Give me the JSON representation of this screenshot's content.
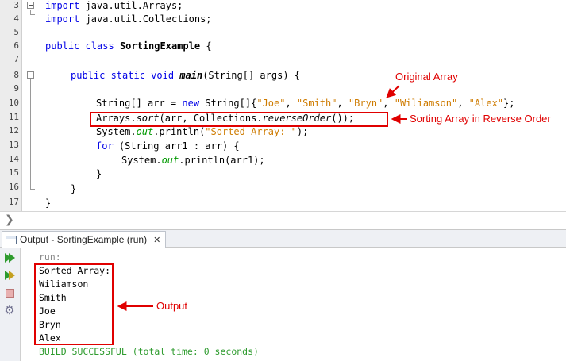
{
  "editor": {
    "line_numbers": [
      "3",
      "4",
      "5",
      "6",
      "7",
      "8",
      "9",
      "10",
      "11",
      "12",
      "13",
      "14",
      "15",
      "16",
      "17"
    ],
    "code": {
      "l3": [
        "import",
        " java.util.Arrays;"
      ],
      "l4": [
        "import",
        " java.util.Collections;"
      ],
      "l6": [
        "public class",
        " ",
        "SortingExample",
        " {"
      ],
      "l8": [
        "public static void",
        " ",
        "main",
        "(String[] args) {"
      ],
      "l10": [
        "String[] arr = ",
        "new",
        " String[]{",
        "\"Joe\"",
        ", ",
        "\"Smith\"",
        ", ",
        "\"Bryn\"",
        ", ",
        "\"Wiliamson\"",
        ", ",
        "\"Alex\"",
        "};"
      ],
      "l11": [
        "Arrays.",
        "sort",
        "(arr, Collections.",
        "reverseOrder",
        "());"
      ],
      "l12": [
        "System.",
        "out",
        ".println(",
        "\"Sorted Array: \"",
        ");"
      ],
      "l13": [
        "for",
        " (String arr1 : arr) {"
      ],
      "l14": [
        "System.",
        "out",
        ".println(arr1);"
      ],
      "l15": "}",
      "l16": "}",
      "l17": "}"
    }
  },
  "annotations": {
    "original_array": "Original Array",
    "sorting_reverse": "Sorting Array in Reverse Order",
    "output": "Output",
    "color": "#e00000"
  },
  "output_window": {
    "tab_title": "Output - SortingExample (run)",
    "close_glyph": "✕",
    "lines": [
      "run:",
      "Sorted Array:",
      "Wiliamson",
      "Smith",
      "Joe",
      "Bryn",
      "Alex"
    ],
    "build": "BUILD SUCCESSFUL (total time: 0 seconds)"
  },
  "toolbar": {
    "icons": [
      "rerun-icon",
      "rerun-with-args-icon",
      "stop-icon",
      "settings-icon"
    ]
  },
  "breadcrumb": {
    "glyph": "❯"
  }
}
